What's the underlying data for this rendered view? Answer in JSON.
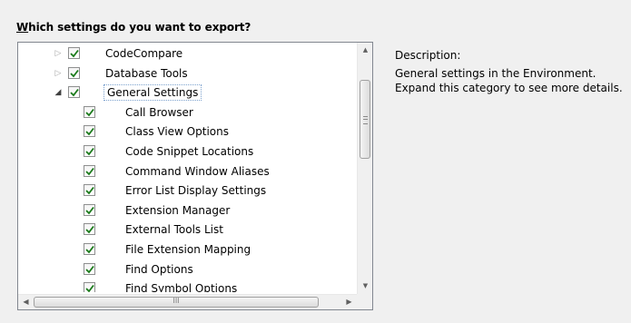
{
  "heading": {
    "accel": "W",
    "rest": "hich settings do you want to export?"
  },
  "tree": {
    "items": [
      {
        "label": "CodeCompare",
        "level": 0,
        "expander": "collapsed",
        "checked": true
      },
      {
        "label": "Database Tools",
        "level": 0,
        "expander": "collapsed",
        "checked": true
      },
      {
        "label": "General Settings",
        "level": 0,
        "expander": "expanded",
        "checked": true,
        "selected": true
      },
      {
        "label": "Call Browser",
        "level": 1,
        "checked": true
      },
      {
        "label": "Class View Options",
        "level": 1,
        "checked": true
      },
      {
        "label": "Code Snippet Locations",
        "level": 1,
        "checked": true
      },
      {
        "label": "Command Window Aliases",
        "level": 1,
        "checked": true
      },
      {
        "label": "Error List Display Settings",
        "level": 1,
        "checked": true
      },
      {
        "label": "Extension Manager",
        "level": 1,
        "checked": true
      },
      {
        "label": "External Tools List",
        "level": 1,
        "checked": true
      },
      {
        "label": "File Extension Mapping",
        "level": 1,
        "checked": true
      },
      {
        "label": "Find Options",
        "level": 1,
        "checked": true
      },
      {
        "label": "Find Symbol Options",
        "level": 1,
        "checked": true
      }
    ],
    "vscroll": {
      "up": "▲",
      "down": "▼",
      "position_fraction": 0.2
    },
    "hscroll": {
      "left": "◀",
      "right": "▶",
      "grip": "III"
    }
  },
  "description": {
    "title": "Description:",
    "line1": "General settings in the Environment.",
    "line2": "Expand this category to see more details."
  },
  "colors": {
    "check": "#1a7a1a",
    "selection_border": "#7da2ce"
  }
}
